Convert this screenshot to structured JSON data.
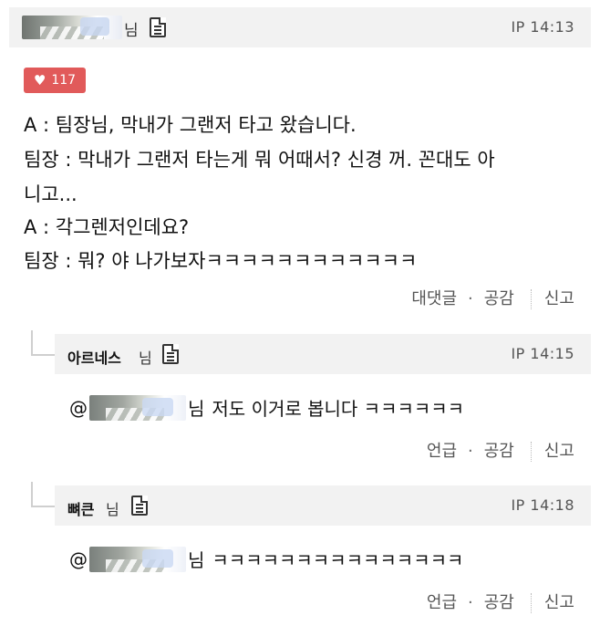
{
  "post": {
    "author_suffix": "님",
    "ip_time": "IP 14:13",
    "likes": "117",
    "lines": [
      "A : 팀장님, 막내가 그랜저 타고 왔습니다.",
      "팀장 : 막내가 그랜저 타는게 뭐 어때서? 신경 꺼. 꼰대도 아",
      "니고...",
      "A : 각그렌저인데요?",
      "팀장 : 뭐? 야 나가보자ㅋㅋㅋㅋㅋㅋㅋㅋㅋㅋㅋㅋ"
    ],
    "actions": {
      "reply": "대댓글",
      "empathy": "공감",
      "report": "신고"
    }
  },
  "replies": [
    {
      "author": "아르네스",
      "suffix": "님",
      "ip_time": "IP 14:15",
      "mention": "@",
      "mention_suffix": "님",
      "text": "저도 이거로 봅니다 ㅋㅋㅋㅋㅋㅋ",
      "actions": {
        "mention": "언급",
        "empathy": "공감",
        "report": "신고"
      }
    },
    {
      "author": "뼈큰",
      "suffix": "님",
      "ip_time": "IP 14:18",
      "mention": "@",
      "mention_suffix": "님",
      "text": "ㅋㅋㅋㅋㅋㅋㅋㅋㅋㅋㅋㅋㅋㅋㅋ",
      "actions": {
        "mention": "언급",
        "empathy": "공감",
        "report": "신고"
      }
    }
  ],
  "colors": {
    "like_bg": "#e15a5a",
    "header_bg": "#f2f2f2"
  },
  "icons": {
    "document": "document-icon",
    "heart": "heart-icon",
    "reply_arrow": "reply-arrow-icon"
  }
}
